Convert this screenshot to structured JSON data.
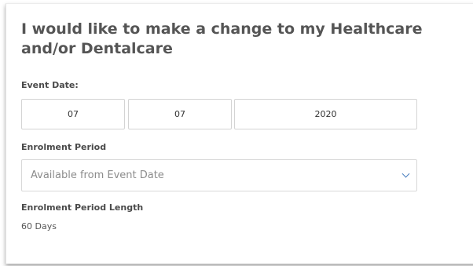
{
  "form": {
    "title": "I would like to make a change to my Healthcare and/or Dentalcare",
    "event_date": {
      "label": "Event Date:",
      "day": "07",
      "month": "07",
      "year": "2020"
    },
    "enrolment_period": {
      "label": "Enrolment Period",
      "selected": "Available from Event Date",
      "icon": "chevron-down-icon"
    },
    "enrolment_period_length": {
      "label": "Enrolment Period Length",
      "value": "60 Days"
    }
  },
  "colors": {
    "title": "#555555",
    "accent": "#4a7fbf",
    "border": "#d4d4d4"
  }
}
